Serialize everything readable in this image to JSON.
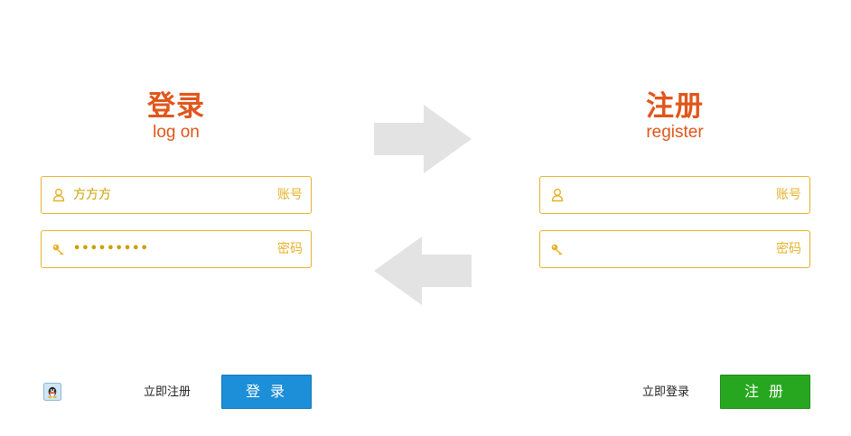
{
  "login": {
    "title": "登录",
    "subtitle": "log on",
    "username": {
      "value": "方方方",
      "label": "账号"
    },
    "password": {
      "value": "•••••••••",
      "label": "密码"
    },
    "register_link": "立即注册",
    "button": "登 录"
  },
  "register": {
    "title": "注册",
    "subtitle": "register",
    "username": {
      "value": "",
      "label": "账号"
    },
    "password": {
      "value": "",
      "label": "密码"
    },
    "login_link": "立即登录",
    "button": "注 册"
  },
  "icons": {
    "user": "user-icon",
    "key": "key-icon",
    "qq": "qq-icon",
    "arrow_right": "arrow-right-icon",
    "arrow_left": "arrow-left-icon"
  },
  "colors": {
    "title": "#e0561b",
    "field_border": "#e6b22a",
    "login_button": "#1c8fd8",
    "register_button": "#27a71f",
    "arrow": "#e3e3e3"
  }
}
